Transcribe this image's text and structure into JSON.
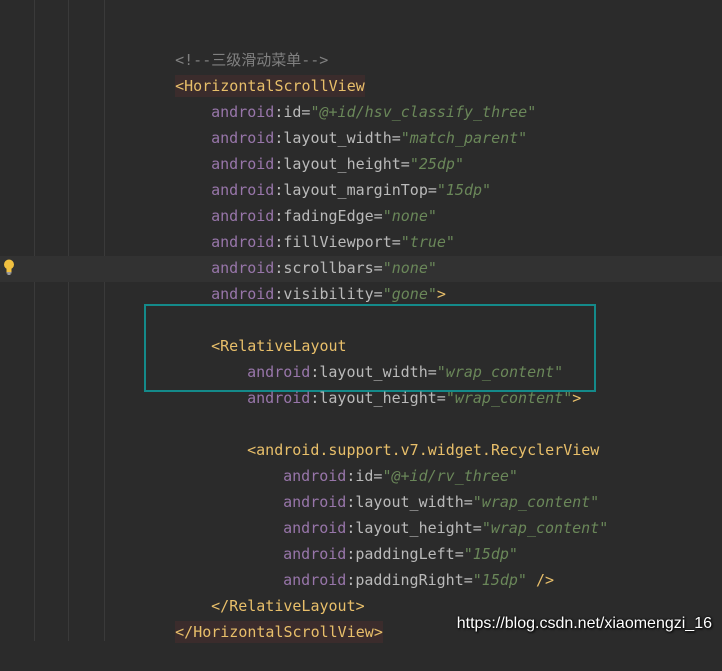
{
  "editor": {
    "lines": [
      {
        "parts": [
          "<!--三级滑动菜单-->"
        ]
      },
      {
        "parts": [
          "<",
          "HorizontalScrollView"
        ]
      },
      {
        "parts": [
          "android",
          ":id=",
          "\"@+id/hsv_classify_three\""
        ]
      },
      {
        "parts": [
          "android",
          ":layout_width=",
          "\"match_parent\""
        ]
      },
      {
        "parts": [
          "android",
          ":layout_height=",
          "\"25dp\""
        ]
      },
      {
        "parts": [
          "android",
          ":layout_marginTop=",
          "\"15dp\""
        ]
      },
      {
        "parts": [
          "android",
          ":fadingEdge=",
          "\"none\""
        ]
      },
      {
        "parts": [
          "android",
          ":fillViewport=",
          "\"true\""
        ]
      },
      {
        "parts": [
          "android",
          ":scrollbars=",
          "\"none\""
        ]
      },
      {
        "parts": [
          "android",
          ":visibility=",
          "\"gone\"",
          ">"
        ]
      },
      {
        "parts": [
          "<",
          "RelativeLayout"
        ]
      },
      {
        "parts": [
          "android",
          ":layout_width=",
          "\"wrap_content\""
        ]
      },
      {
        "parts": [
          "android",
          ":layout_height=",
          "\"wrap_content\"",
          ">"
        ]
      },
      {
        "parts": [
          "<",
          "android.support.v7.widget.RecyclerView"
        ]
      },
      {
        "parts": [
          "android",
          ":id=",
          "\"@+id/rv_three\""
        ]
      },
      {
        "parts": [
          "android",
          ":layout_width=",
          "\"wrap_content\""
        ]
      },
      {
        "parts": [
          "android",
          ":layout_height=",
          "\"wrap_content\""
        ]
      },
      {
        "parts": [
          "android",
          ":paddingLeft=",
          "\"15dp\""
        ]
      },
      {
        "parts": [
          "android",
          ":paddingRight=",
          "\"15dp\"",
          " />"
        ]
      },
      {
        "parts": [
          "</",
          "RelativeLayout",
          ">"
        ]
      },
      {
        "parts": [
          "</",
          "HorizontalScrollView",
          ">"
        ]
      }
    ]
  },
  "gutter": {
    "intention_icon": "lightbulb-icon"
  },
  "watermark": {
    "text": "https://blog.csdn.net/xiaomengzi_16"
  },
  "colors": {
    "background": "#2b2b2b",
    "comment": "#808080",
    "tag": "#e8bf6a",
    "namespace": "#9876aa",
    "attribute": "#bababa",
    "string": "#6a8759",
    "highlight_box": "#148a8a"
  }
}
